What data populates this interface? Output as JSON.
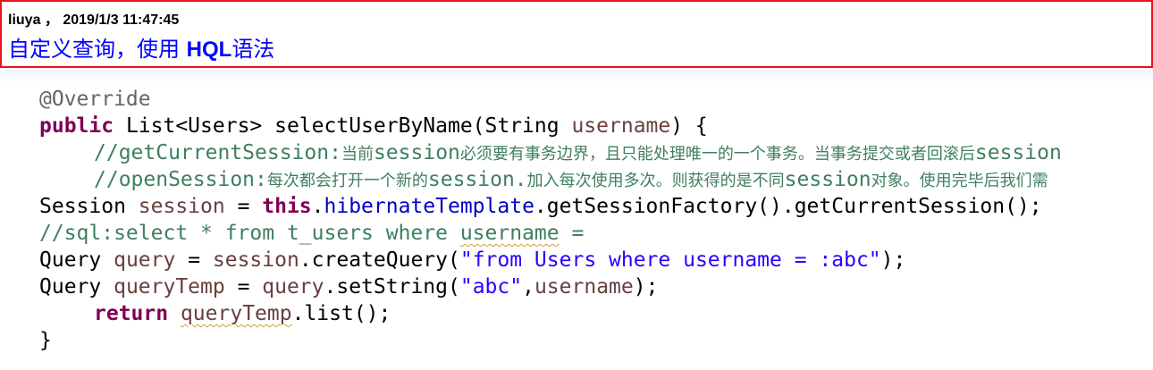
{
  "note": {
    "meta": "liuya ， 2019/1/3 11:47:45",
    "title_prefix": "自定义查询，使用 ",
    "title_hql": "HQL",
    "title_suffix": "语法"
  },
  "code": {
    "l1": "@Override",
    "l2_kw": "public",
    "l2_a": " List<Users> selectUserByName(String ",
    "l2_var": "username",
    "l2_b": ") {",
    "l3_a": "//getCurrentSession:",
    "l3_b": "当前",
    "l3_c": "session",
    "l3_d": "必须要有事务边界，且只能处理唯一的一个事务。当事务提交或者回滚后",
    "l3_e": "session",
    "l4_a": "//openSession:",
    "l4_b": "每次都会打开一个新的",
    "l4_c": "session.",
    "l4_d": "加入每次使用多次。则获得的是不同",
    "l4_e": "session",
    "l4_f": "对象。使用完毕后我们需",
    "l5_a": "Session ",
    "l5_var": "session",
    "l5_b": " = ",
    "l5_kw": "this",
    "l5_c": ".",
    "l5_fld": "hibernateTemplate",
    "l5_d": ".getSessionFactory().getCurrentSession();",
    "l6_a": "//sql:select * from t_users where ",
    "l6_b": "username",
    "l6_c": " =",
    "l7_a": "Query ",
    "l7_var1": "query",
    "l7_b": " = ",
    "l7_var2": "session",
    "l7_c": ".createQuery(",
    "l7_str": "\"from Users where username = :abc\"",
    "l7_d": ");",
    "l8_a": "Query ",
    "l8_var1": "queryTemp",
    "l8_b": " = ",
    "l8_var2": "query",
    "l8_c": ".setString(",
    "l8_str": "\"abc\"",
    "l8_d": ",",
    "l8_var3": "username",
    "l8_e": ");",
    "l9_kw": "return",
    "l9_a": " ",
    "l9_var": "queryTemp",
    "l9_b": ".list();",
    "l10": "}"
  },
  "colors": {
    "note_border": "#e8141b",
    "note_title": "#0000ff",
    "keyword": "#7f0055",
    "comment": "#3f7f5f",
    "string": "#2a00ff",
    "field": "#0000c0",
    "local_variable": "#6a3e3e",
    "annotation": "#646464"
  }
}
